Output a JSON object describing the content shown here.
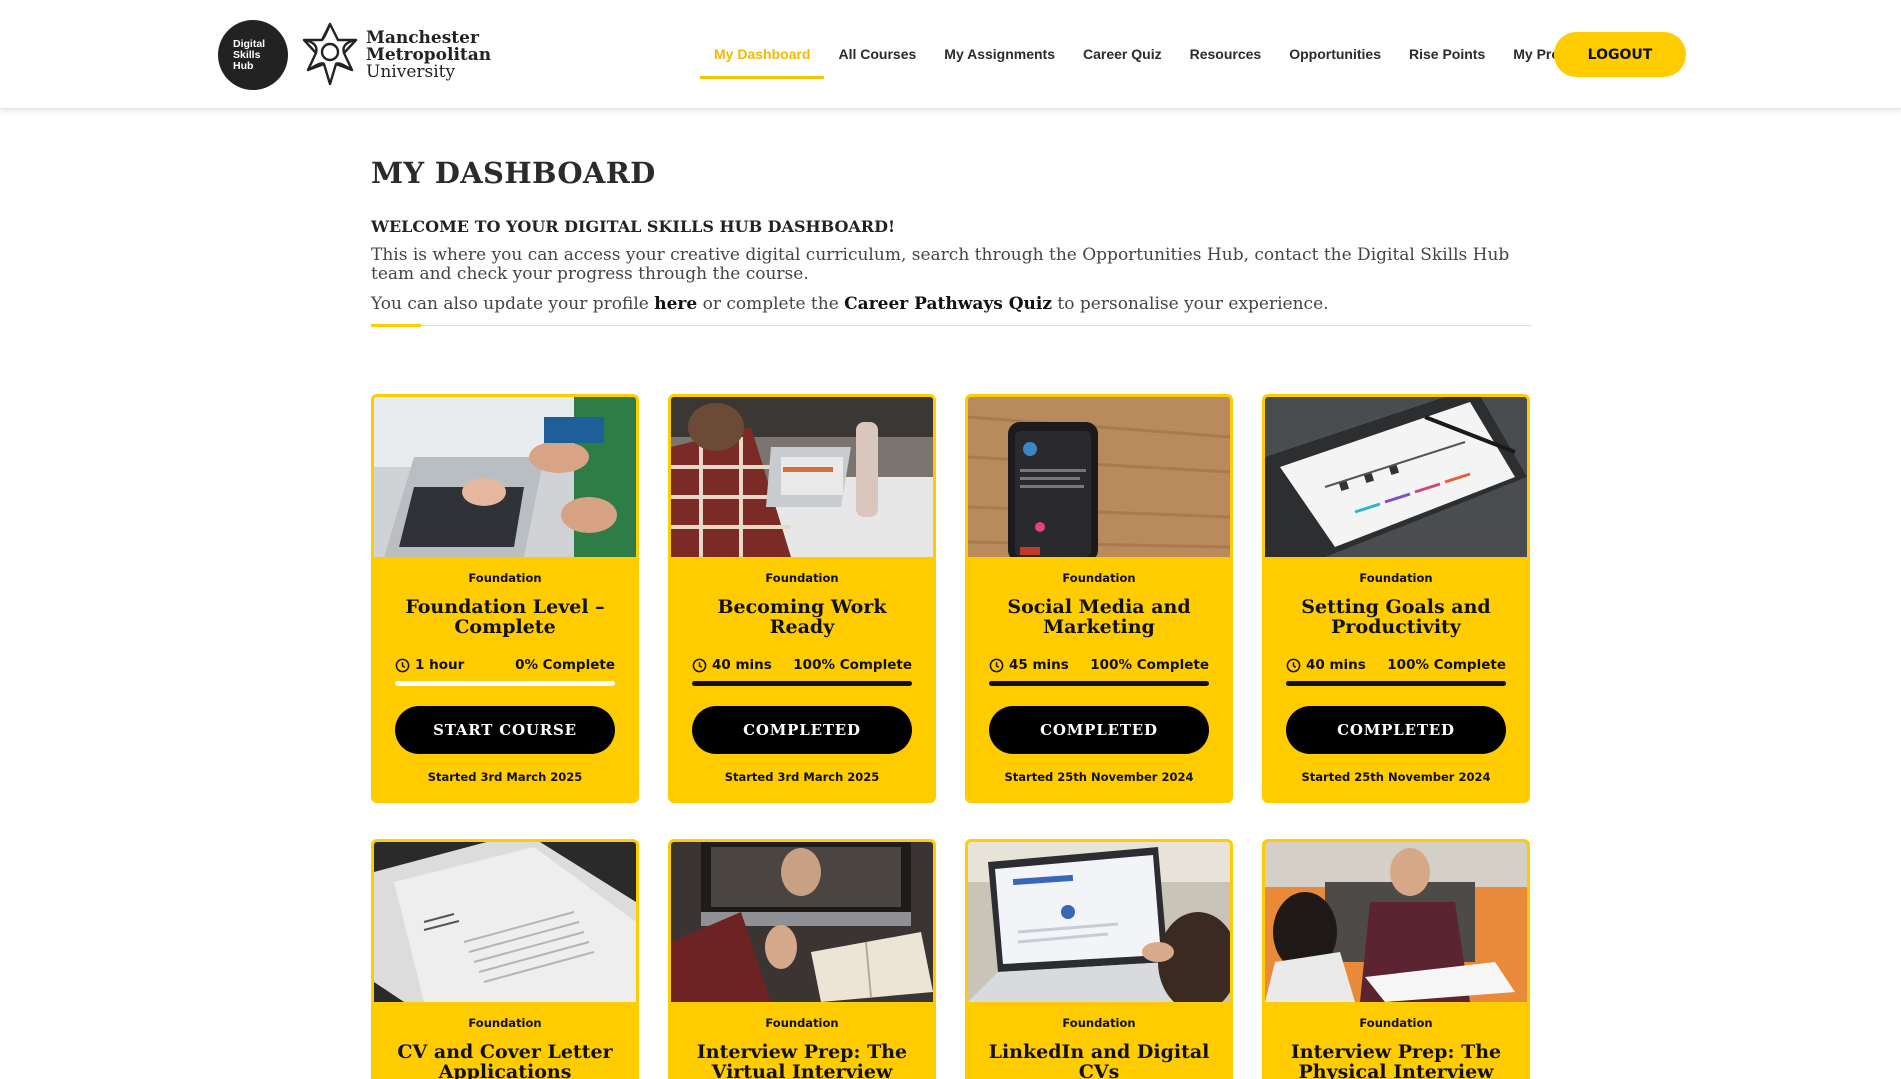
{
  "logo": {
    "hub_line1": "Digital",
    "hub_line2": "Skills",
    "hub_line3": "Hub",
    "uni_line1": "Manchester",
    "uni_line2": "Metropolitan",
    "uni_line3": "University"
  },
  "nav": {
    "items": [
      {
        "label": "My Dashboard",
        "active": true
      },
      {
        "label": "All Courses"
      },
      {
        "label": "My Assignments"
      },
      {
        "label": "Career Quiz"
      },
      {
        "label": "Resources"
      },
      {
        "label": "Opportunities"
      },
      {
        "label": "Rise Points"
      },
      {
        "label": "My Profile"
      }
    ],
    "logout": "LOGOUT"
  },
  "intro": {
    "title": "MY DASHBOARD",
    "welcome": "WELCOME TO YOUR DIGITAL SKILLS HUB DASHBOARD!",
    "paragraph1": "This is where you can access your creative digital curriculum, search through the Opportunities Hub, contact the Digital Skills Hub team and check your progress through the course.",
    "paragraph2_pre": "You can also update your profile ",
    "profile_link": "here",
    "paragraph2_mid": " or complete the ",
    "quiz_link": "Career Pathways Quiz",
    "paragraph2_post": " to personalise your experience."
  },
  "colors": {
    "accent": "#ffcc00",
    "nav_active": "#f5b800",
    "button": "#000000"
  },
  "courses": [
    {
      "level": "Foundation",
      "title": "Foundation Level – Complete",
      "duration": "1 hour",
      "progress_label": "0% Complete",
      "progress": 0,
      "button": "START COURSE",
      "started": "Started 3rd March 2025",
      "image": "laptop-hands-photo"
    },
    {
      "level": "Foundation",
      "title": "Becoming Work Ready",
      "duration": "40 mins",
      "progress_label": "100% Complete",
      "progress": 1,
      "button": "COMPLETED",
      "started": "Started 3rd March 2025",
      "image": "student-laptop-photo"
    },
    {
      "level": "Foundation",
      "title": "Social Media and Marketing",
      "duration": "45 mins",
      "progress_label": "100% Complete",
      "progress": 1,
      "button": "COMPLETED",
      "started": "Started 25th November 2024",
      "image": "smartphone-photo"
    },
    {
      "level": "Foundation",
      "title": "Setting Goals and Productivity",
      "duration": "40 mins",
      "progress_label": "100% Complete",
      "progress": 1,
      "button": "COMPLETED",
      "started": "Started 25th November 2024",
      "image": "project-timeline-photo"
    },
    {
      "level": "Foundation",
      "title": "CV and Cover Letter Applications",
      "image": "cv-document-photo"
    },
    {
      "level": "Foundation",
      "title": "Interview Prep: The Virtual Interview",
      "image": "video-call-photo"
    },
    {
      "level": "Foundation",
      "title": "LinkedIn and Digital CVs",
      "image": "laptop-linkedin-photo"
    },
    {
      "level": "Foundation",
      "title": "Interview Prep: The Physical Interview",
      "image": "interview-photo"
    }
  ]
}
